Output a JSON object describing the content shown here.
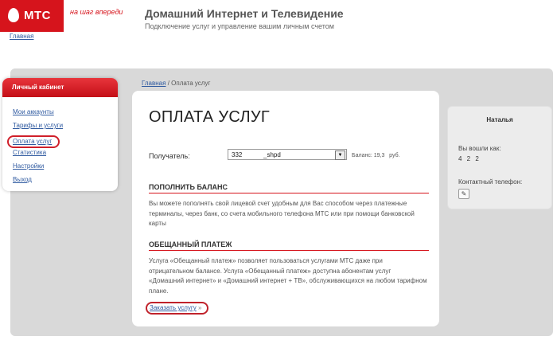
{
  "header": {
    "logo_text": "МТС",
    "slogan": "на шаг впереди",
    "title": "Домашний Интернет и Телевидение",
    "subtitle": "Подключение услуг и управление вашим личным счетом",
    "home_link": "Главная"
  },
  "sidebar": {
    "title": "Личный кабинет",
    "items": [
      {
        "label": "Мои аккаунты"
      },
      {
        "label": "Тарифы и услуги"
      },
      {
        "label": "Оплата услуг"
      },
      {
        "label": "Статистика"
      },
      {
        "label": "Настройки"
      },
      {
        "label": "Выход"
      }
    ]
  },
  "breadcrumb": {
    "home": "Главная",
    "separator": "/",
    "current": "Оплата услуг"
  },
  "main": {
    "heading": "ОПЛАТА УСЛУГ",
    "recipient_label": "Получатель:",
    "recipient_value": "332            _shpd",
    "balance_text": "Баланс: 19,3   руб.",
    "section1_title": "ПОПОЛНИТЬ БАЛАНС",
    "section1_text": "Вы можете пополнять свой лицевой счет удобным для Вас способом через платежные терминалы, через банк, со счета мобильного телефона МТС или при помощи банковской карты",
    "section2_title": "ОБЕЩАННЫЙ ПЛАТЕЖ",
    "section2_text": "Услуга «Обещанный платеж» позволяет пользоваться услугами МТС даже при отрицательном балансе. Услуга «Обещанный платеж» доступна абонентам услуг «Домашний интернет» и «Домашний интернет + ТВ», обслуживающихся на любом тарифном плане.",
    "order_link": "Заказать услугу",
    "order_arrow": "»"
  },
  "user": {
    "name": "Наталья",
    "logged_in_label": "Вы вошли как:",
    "logged_in_value": "4 2 2",
    "phone_label": "Контактный телефон:"
  },
  "colors": {
    "brand_red": "#d6141c",
    "link_blue": "#2f5aa0",
    "panel_gray": "#d9d9d9"
  },
  "icons": [
    "mts-logo-icon",
    "dropdown-arrow-icon",
    "edit-pencil-icon"
  ]
}
